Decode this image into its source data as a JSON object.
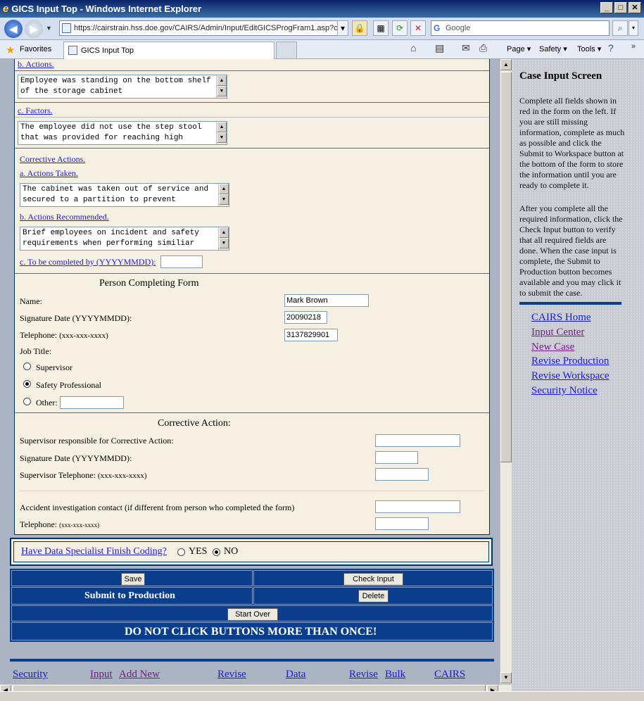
{
  "window": {
    "title": "GICS Input Top - Windows Internet Explorer"
  },
  "browser": {
    "url": "https://cairstrain.hss.doe.gov/CAIRS/Admin/Input/EditGICSProgFram1.asp?c",
    "search_placeholder": "Google",
    "favorites_label": "Favorites",
    "tab_title": "GICS Input Top",
    "commands": {
      "page": "Page",
      "safety": "Safety",
      "tools": "Tools"
    }
  },
  "form": {
    "actions_link": "b. Actions.",
    "actions_text": "Employee was standing on the bottom shelf of the storage cabinet",
    "factors_link": "c. Factors.",
    "factors_text": "The employee did not use the step stool that was provided for reaching high",
    "corrective_link": "Corrective Actions.",
    "actions_taken_link": "a. Actions Taken.",
    "actions_taken_text": "The cabinet was taken out of service and secured to a partition to prevent",
    "actions_recommended_link": "b. Actions Recommended.",
    "actions_recommended_text": "Brief employees on incident and safety requirements when performing similiar",
    "complete_by_link": "c. To be completed by (YYYYMMDD):",
    "complete_by_value": "",
    "person_title": "Person Completing Form",
    "name_label": "Name:",
    "name_value": "Mark Brown",
    "sigdate_label": "Signature Date (YYYYMMDD):",
    "sigdate_value": "20090218",
    "phone_label": "Telephone:",
    "phone_hint": "(xxx-xxx-xxxx)",
    "phone_value": "3137829901",
    "jobtitle_label": "Job Title:",
    "job_options": [
      "Supervisor",
      "Safety Professional",
      "Other:"
    ],
    "job_selected": "Safety Professional",
    "other_value": "",
    "ca_title": "Corrective Action:",
    "ca_supervisor_label": "Supervisor responsible for Corrective Action:",
    "ca_sigdate_label": "Signature Date (YYYYMMDD):",
    "ca_phone_label": "Supervisor Telephone:",
    "ca_phone_hint": "(xxx-xxx-xxxx)",
    "contact_label": "Accident investigation contact (if different from person who completed the form)",
    "contact_phone_label": "Telephone:",
    "contact_phone_hint": "(xxx-xxx-xxxx)"
  },
  "coding": {
    "question": "Have Data Specialist Finish Coding?",
    "yes": "YES",
    "no": "NO",
    "selected": "NO"
  },
  "buttons": {
    "save": "Save",
    "check_input": "Check Input",
    "submit_text": "Submit to Production",
    "delete": "Delete",
    "start_over": "Start Over",
    "warning": "DO NOT CLICK BUTTONS MORE THAN ONCE!"
  },
  "footer_links": [
    "Security",
    "Input",
    "Add New",
    "Revise",
    "Data",
    "Revise",
    "Bulk",
    "CAIRS"
  ],
  "sidebar": {
    "title": "Case Input Screen",
    "para1": "Complete all fields shown in red in the form on the left. If you are still missing information, complete as much as possible and click the Submit to Workspace button at the bottom of the form to store the information until you are ready to complete it.",
    "para2": "After you complete all the required information, click the Check Input button to verify that all required fields are done. When the case input is complete, the Submit to Production button becomes available and you may click it to submit the case.",
    "links": [
      "CAIRS Home",
      "Input Center",
      "New Case",
      "Revise Production",
      "Revise Workspace",
      "Security Notice"
    ]
  }
}
